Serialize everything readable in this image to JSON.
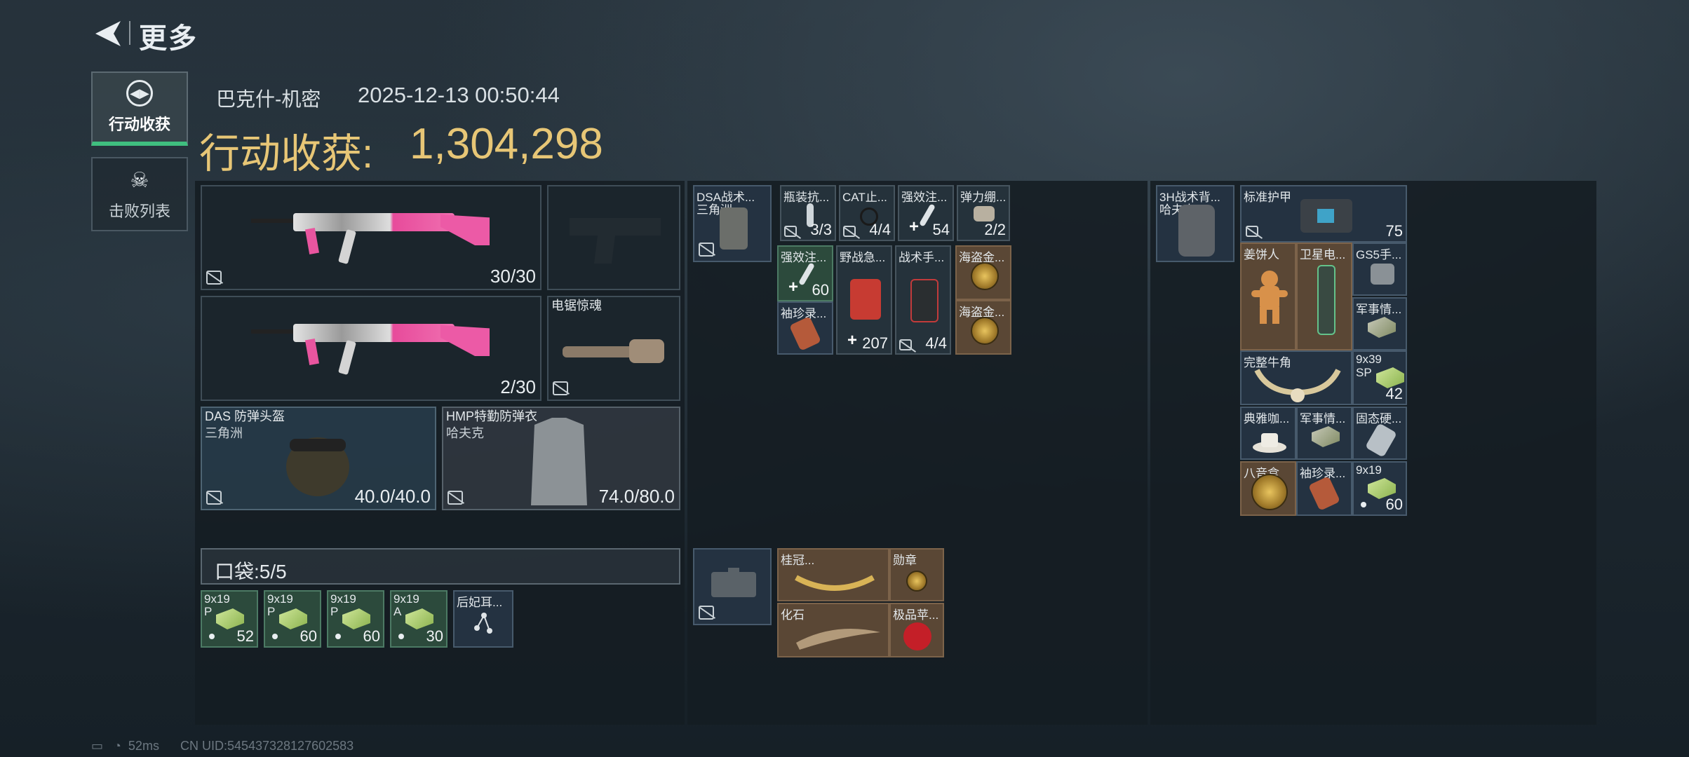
{
  "header": {
    "title": "更多"
  },
  "sidebar": {
    "items": [
      {
        "label": "行动收获",
        "active": true
      },
      {
        "label": "击败列表",
        "active": false
      }
    ]
  },
  "summary": {
    "map": "巴克什-机密",
    "time": "2025-12-13 00:50:44",
    "haul_label": "行动收获:",
    "haul_value": "1,304,298"
  },
  "equipment": {
    "primary1": {
      "ammo": "30/30"
    },
    "primary2": {
      "ammo": "2/30"
    },
    "melee": {
      "label": "电锯惊魂"
    },
    "helmet": {
      "name": "DAS 防弹头盔",
      "brand": "三角洲",
      "durability": "40.0/40.0"
    },
    "armor": {
      "name": "HMP特勤防弹衣",
      "brand": "哈夫克",
      "durability": "74.0/80.0"
    }
  },
  "pocket": {
    "label": "口袋:5/5",
    "items": [
      {
        "c1": "9x19",
        "c2": "P",
        "qty": "52"
      },
      {
        "c1": "9x19",
        "c2": "P",
        "qty": "60"
      },
      {
        "c1": "9x19",
        "c2": "P",
        "qty": "60"
      },
      {
        "c1": "9x19",
        "c2": "A",
        "qty": "30"
      },
      {
        "c1": "后妃耳...",
        "c2": "",
        "qty": ""
      }
    ]
  },
  "rig": {
    "name": "DSA战术...",
    "brand": "三角洲",
    "items": [
      {
        "label": "瓶装抗...",
        "qty": "3/3"
      },
      {
        "label": "CAT止...",
        "qty": "4/4"
      },
      {
        "label": "强效注...",
        "qty": "54"
      },
      {
        "label": "弹力绷...",
        "qty": "2/2"
      },
      {
        "label": "强效注...",
        "qty": "60"
      },
      {
        "label": "野战急...",
        "qty": "207"
      },
      {
        "label": "战术手...",
        "qty": "4/4"
      },
      {
        "label": "海盗金...",
        "qty": ""
      },
      {
        "label": "袖珍录...",
        "qty": ""
      },
      {
        "label": "海盗金...",
        "qty": ""
      }
    ]
  },
  "case": {
    "items": [
      {
        "label": "桂冠..."
      },
      {
        "label": "勋章"
      },
      {
        "label": "化石"
      },
      {
        "label": "极品苹..."
      }
    ]
  },
  "backpack": {
    "name": "3H战术背...",
    "brand": "哈夫克",
    "items": [
      {
        "label": "标准护甲",
        "qty": "75"
      },
      {
        "label": "姜饼人",
        "qty": ""
      },
      {
        "label": "卫星电...",
        "qty": ""
      },
      {
        "label": "GS5手...",
        "qty": ""
      },
      {
        "label": "军事情...",
        "qty": ""
      },
      {
        "label": "完整牛角",
        "qty": ""
      },
      {
        "label": "9x39 SP",
        "qty": "42"
      },
      {
        "label": "典雅咖...",
        "qty": ""
      },
      {
        "label": "军事情...",
        "qty": ""
      },
      {
        "label": "固态硬...",
        "qty": ""
      },
      {
        "label": "八音盒",
        "qty": ""
      },
      {
        "label": "袖珍录...",
        "qty": ""
      },
      {
        "label": "9x19",
        "qty": "60"
      }
    ]
  },
  "status": {
    "ping": "52ms",
    "uid": "CN UID:545437328127602583"
  }
}
